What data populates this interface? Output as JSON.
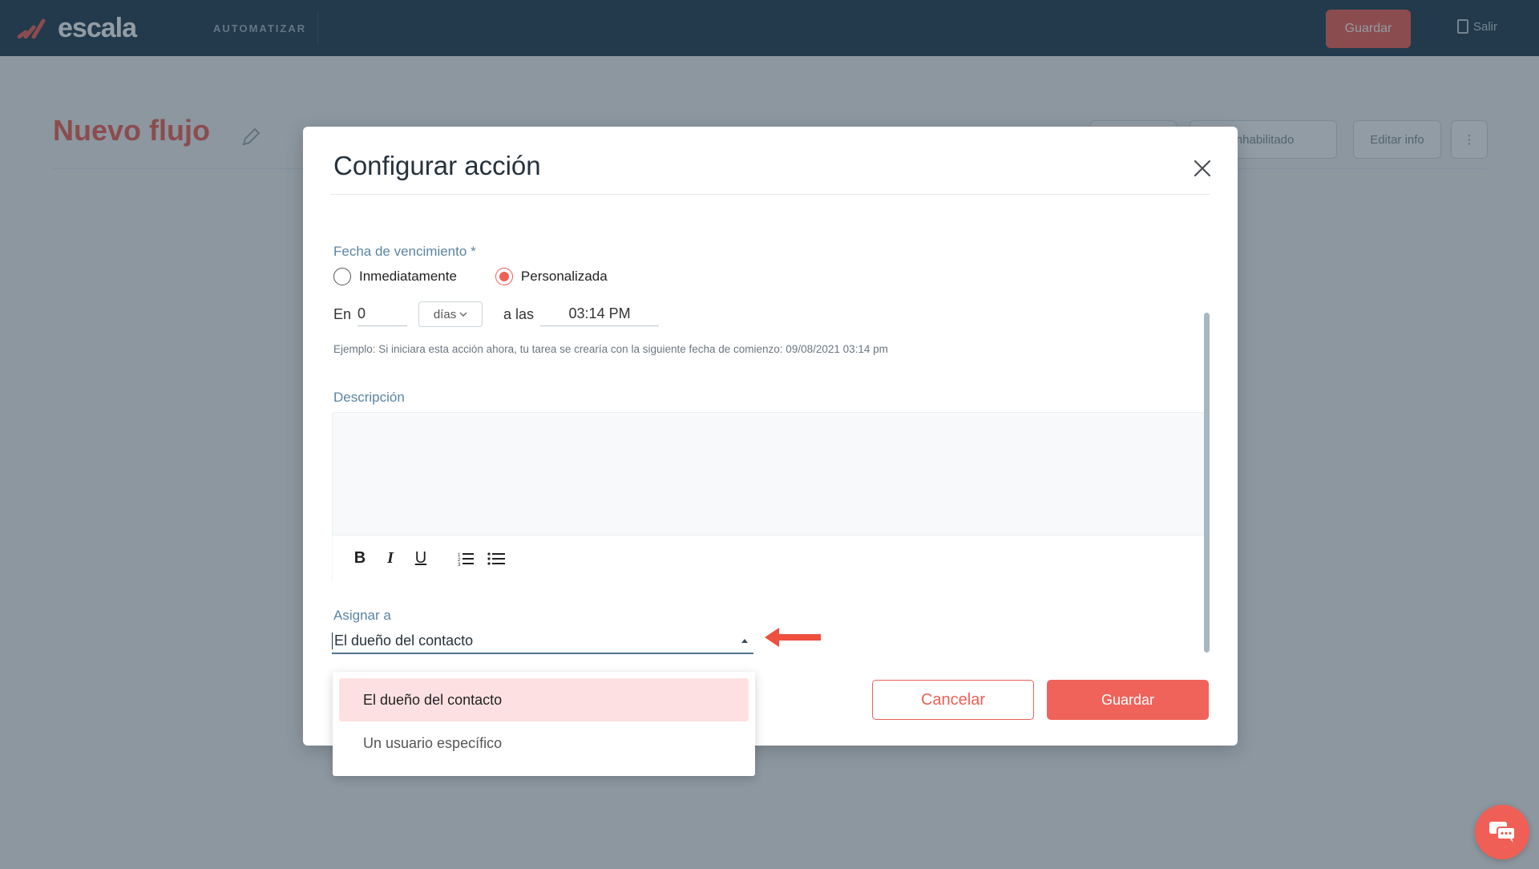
{
  "topbar": {
    "logo_text": "escala",
    "section": "AUTOMATIZAR",
    "save_label": "Guardar",
    "logout_label": "Salir"
  },
  "page": {
    "flow_title": "Nuevo flujo",
    "status_button": "Inhabilitado",
    "edit_info_button": "Editar info"
  },
  "modal": {
    "title": "Configurar acción",
    "due_date": {
      "label": "Fecha de vencimiento",
      "required_mark": "*",
      "options": [
        "Inmediatamente",
        "Personalizada"
      ],
      "selected": "Personalizada",
      "prefix": "En",
      "amount": "0",
      "unit": "días",
      "at_label": "a las",
      "time": "03:14 PM",
      "example": "Ejemplo: Si iniciara esta acción ahora, tu tarea se crearía con la siguiente fecha de comienzo: 09/08/2021 03:14 pm"
    },
    "description": {
      "label": "Descripción",
      "toolbar": {
        "bold": "B",
        "italic": "I",
        "underline": "U"
      }
    },
    "assign": {
      "label": "Asignar a",
      "value": "El dueño del contacto",
      "options": [
        "El dueño del contacto",
        "Un usuario específico"
      ],
      "selected_index": 0
    },
    "cancel_label": "Cancelar",
    "save_label": "Guardar"
  },
  "colors": {
    "brand": "#f05f55",
    "topbar": "#1f3a4f",
    "label": "#5c84a3",
    "selected_option": "#fde1e2"
  }
}
